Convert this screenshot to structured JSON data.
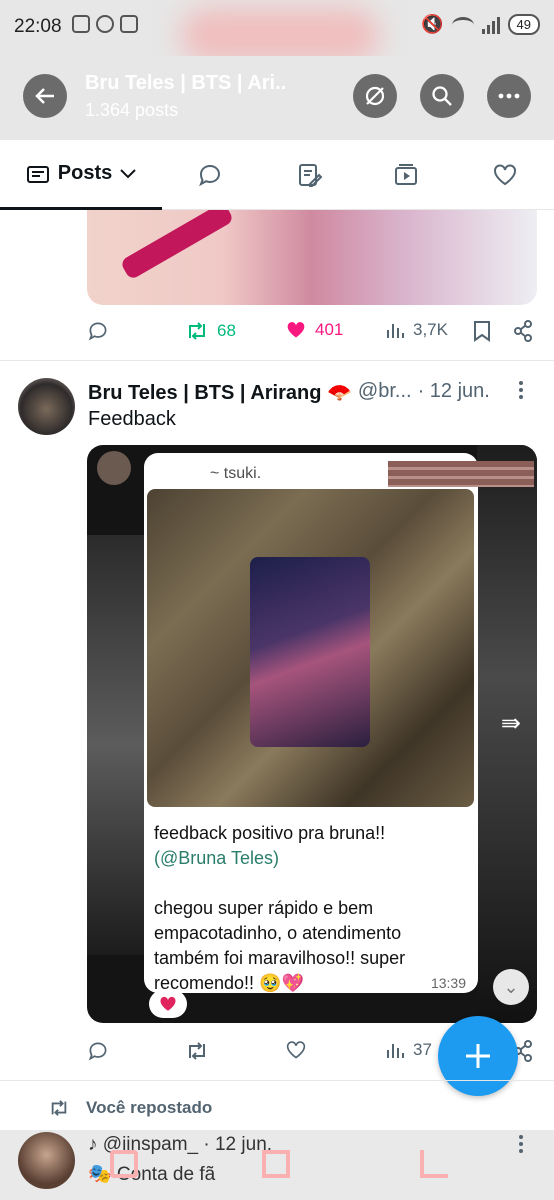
{
  "status_bar": {
    "time": "22:08",
    "battery": "49"
  },
  "header": {
    "title": "Bru Teles | BTS | Ari...",
    "subtitle": "1.364 posts"
  },
  "tabs": {
    "posts_label": "Posts"
  },
  "post1": {
    "retweets": "68",
    "likes": "401",
    "views": "3,7K"
  },
  "post2": {
    "name": "Bru Teles | BTS | Arirang 🪭",
    "handle": "@br...",
    "date": "· 12 jun.",
    "text": "Feedback",
    "media": {
      "sender": "~ tsuki.",
      "message_line1": "feedback positivo pra bruna!!",
      "mention": "(@Bruna Teles)",
      "message_line2": "chegou super rápido e bem empacotadinho, o atendimento também foi maravilhoso!! super recomendo!! 🥹💖",
      "time": "13:39"
    },
    "views": "37"
  },
  "repost": {
    "label": "Você repostado"
  },
  "post3": {
    "handle_date": "♪ @jinspam_ · 12 jun.",
    "subline": "🎭 Conta de fã"
  },
  "colors": {
    "accent": "#1d9bf0",
    "retweet": "#00ba7c",
    "like": "#f91880"
  }
}
